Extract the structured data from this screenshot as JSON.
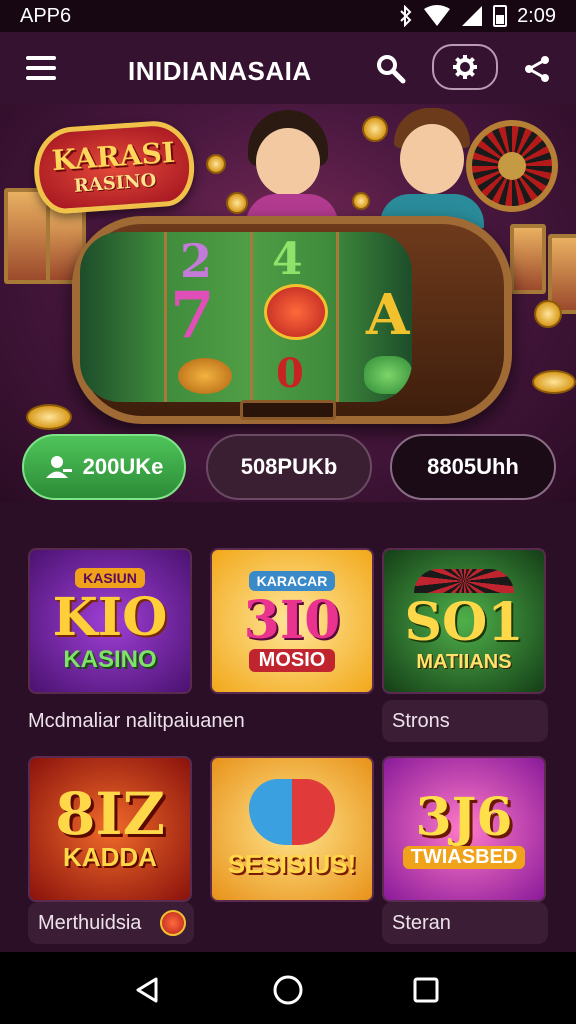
{
  "status_bar": {
    "left_text": "APP6",
    "time": "2:09"
  },
  "app_bar": {
    "title": "INIDIANASAIA",
    "menu_icon": "hamburger-icon",
    "search_icon": "search-icon",
    "settings_icon": "gear-icon",
    "share_icon": "share-icon"
  },
  "hero": {
    "logo_line1": "KARASI",
    "logo_line2": "RASINO",
    "reel_symbols": [
      "2",
      "4",
      "7",
      "A",
      "0"
    ]
  },
  "actions": [
    {
      "label": "200UKe",
      "icon": "user-icon"
    },
    {
      "label": "508PUKb"
    },
    {
      "label": "8805Uhh"
    }
  ],
  "games": [
    {
      "top_text": "KASIUN",
      "big_text": "KIO",
      "sub_text": "KASINO"
    },
    {
      "top_text": "KARACAR",
      "big_text": "3I0",
      "sub_text": "MOSIO"
    },
    {
      "top_text": "",
      "big_text": "SO1",
      "sub_text": "MATIIANS"
    },
    {
      "top_text": "",
      "big_text": "8IZ",
      "sub_text": "KADDA"
    },
    {
      "top_text": "",
      "big_text": "",
      "sub_text": "SESISIUS!"
    },
    {
      "top_text": "",
      "big_text": "3J6",
      "sub_text": "TWIASBED"
    }
  ],
  "labels": {
    "row1_left": "Mcdmaliar nalitpaiuanen",
    "row1_right": "Strons",
    "row2_left": "Merthuidsia",
    "row2_right": "Steran"
  },
  "nav": {
    "back_icon": "back-triangle-icon",
    "home_icon": "home-circle-icon",
    "recents_icon": "recents-square-icon"
  }
}
